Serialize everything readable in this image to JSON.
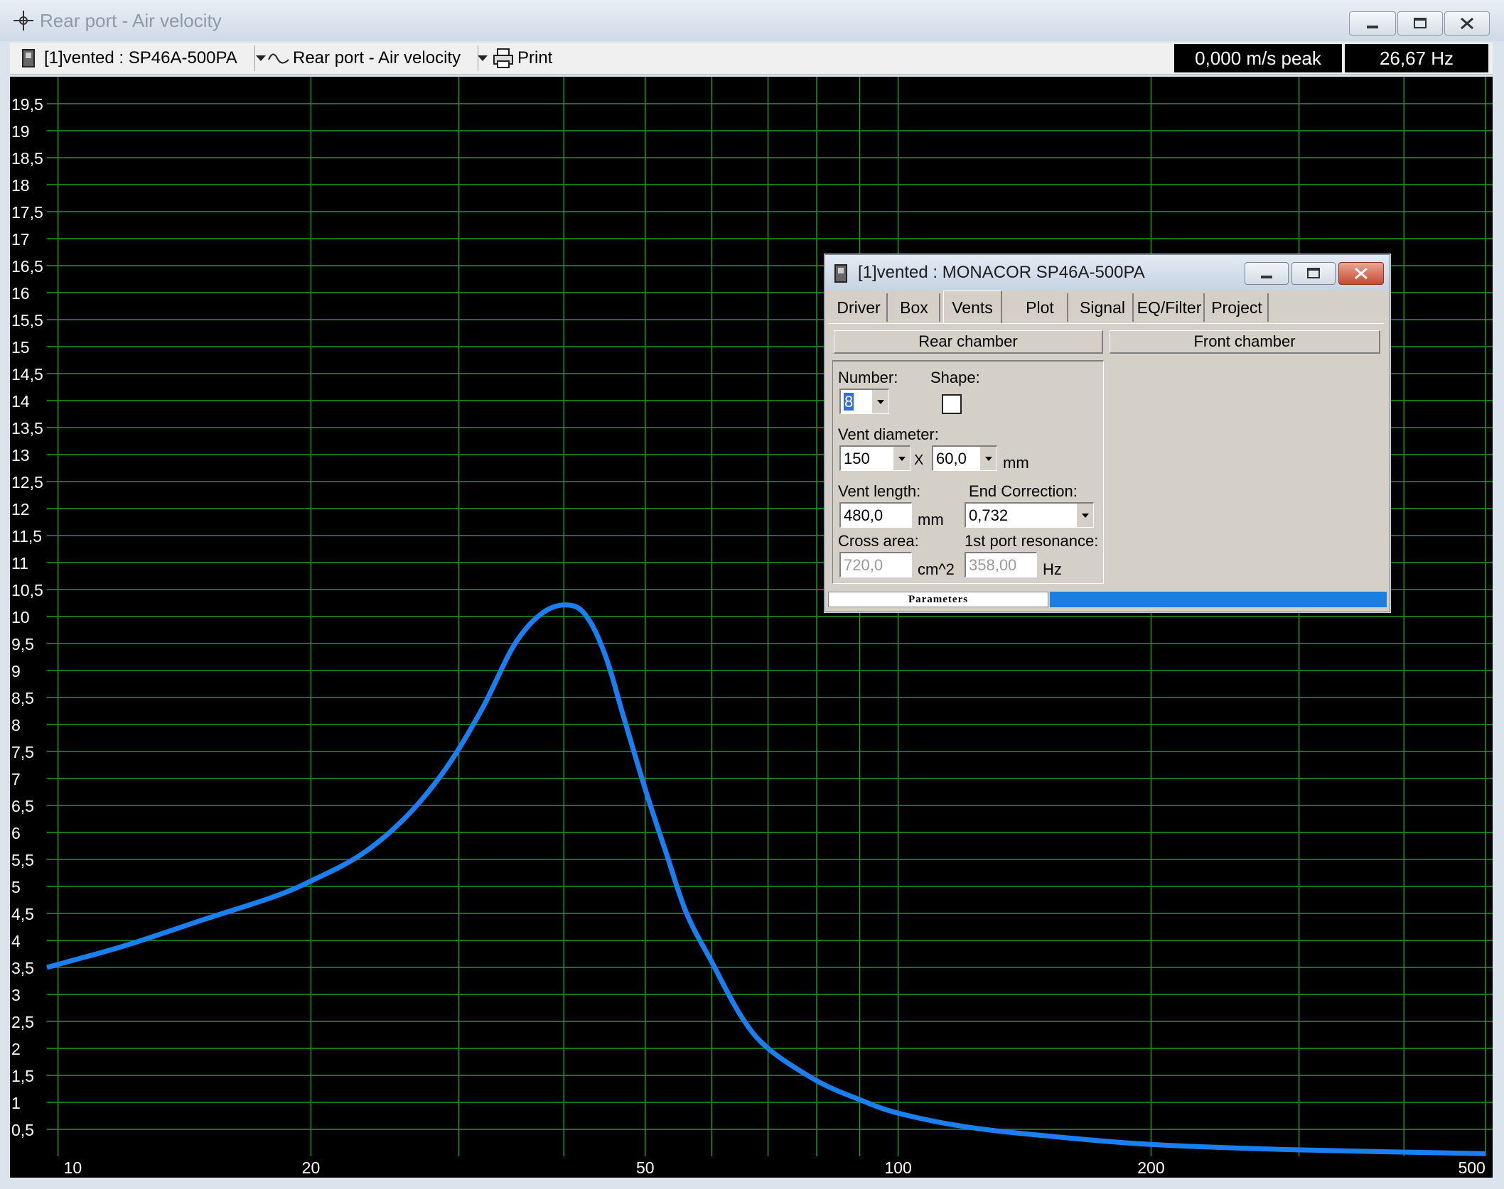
{
  "window": {
    "title": "Rear port - Air velocity",
    "buttons": [
      "minimize",
      "maximize",
      "close"
    ]
  },
  "toolbar": {
    "project_label": "[1]vented : SP46A-500PA",
    "graph_label": "Rear port - Air velocity",
    "print_label": "Print",
    "readout_peak": "0,000 m/s peak",
    "readout_freq": "26,67 Hz"
  },
  "chart_data": {
    "type": "line",
    "title": "",
    "xlabel": "",
    "ylabel": "",
    "x_scale": "log",
    "xlim": [
      9.7,
      510
    ],
    "ylim": [
      0,
      20
    ],
    "grid": true,
    "x_ticks": [
      "10",
      "20",
      "50",
      "100",
      "200",
      "500"
    ],
    "x_tick_values": [
      10,
      20,
      50,
      100,
      200,
      500
    ],
    "x_grid": [
      10,
      20,
      30,
      40,
      50,
      60,
      70,
      80,
      90,
      100,
      200,
      300,
      400,
      500
    ],
    "y_ticks": [
      "0,5",
      "1",
      "1,5",
      "2",
      "2,5",
      "3",
      "3,5",
      "4",
      "4,5",
      "5",
      "5,5",
      "6",
      "6,5",
      "7",
      "7,5",
      "8",
      "8,5",
      "9",
      "9,5",
      "10",
      "10,5",
      "11",
      "11,5",
      "12",
      "12,5",
      "13",
      "13,5",
      "14",
      "14,5",
      "15",
      "15,5",
      "16",
      "16,5",
      "17",
      "17,5",
      "18",
      "18,5",
      "19",
      "19,5"
    ],
    "y_tick_values": [
      0.5,
      1,
      1.5,
      2,
      2.5,
      3,
      3.5,
      4,
      4.5,
      5,
      5.5,
      6,
      6.5,
      7,
      7.5,
      8,
      8.5,
      9,
      9.5,
      10,
      10.5,
      11,
      11.5,
      12,
      12.5,
      13,
      13.5,
      14,
      14.5,
      15,
      15.5,
      16,
      16.5,
      17,
      17.5,
      18,
      18.5,
      19,
      19.5
    ],
    "line_color": "#1a7ff0",
    "grid_color": "#1f9a1f",
    "series": [
      {
        "color": "#1a7ff0",
        "x": [
          9.7,
          12,
          15,
          18,
          20,
          23,
          26,
          29,
          32,
          35,
          38,
          41,
          43,
          45,
          47,
          50,
          53,
          56,
          60,
          65,
          70,
          80,
          90,
          100,
          120,
          150,
          200,
          300,
          500
        ],
        "y": [
          3.5,
          3.9,
          4.4,
          4.8,
          5.1,
          5.6,
          6.3,
          7.2,
          8.3,
          9.5,
          10.1,
          10.2,
          9.9,
          9.2,
          8.2,
          6.8,
          5.6,
          4.5,
          3.6,
          2.6,
          2.0,
          1.4,
          1.05,
          0.8,
          0.55,
          0.38,
          0.22,
          0.12,
          0.05
        ]
      }
    ]
  },
  "dialog": {
    "title": "[1]vented : MONACOR SP46A-500PA",
    "tabs": [
      "Driver",
      "Box",
      "Vents",
      "Plot",
      "Signal",
      "EQ/Filter",
      "Project"
    ],
    "active_tab": "Vents",
    "rear_chamber_label": "Rear chamber",
    "front_chamber_label": "Front chamber",
    "number_label": "Number:",
    "number_value": "8",
    "shape_label": "Shape:",
    "vent_diameter_label": "Vent diameter:",
    "vent_diameter_value": "150",
    "vent_x_symbol": "X",
    "vent_second_value": "60,0",
    "mm_unit": "mm",
    "vent_length_label": "Vent length:",
    "vent_length_value": "480,0",
    "end_correction_label": "End Correction:",
    "end_correction_value": "0,732",
    "cross_area_label": "Cross area:",
    "cross_area_value": "720,0",
    "cross_area_unit": "cm^2",
    "port_resonance_label": "1st port resonance:",
    "port_resonance_value": "358,00",
    "hz_unit": "Hz",
    "status_label": "Parameters",
    "status_accent": "#1a7fe0"
  }
}
